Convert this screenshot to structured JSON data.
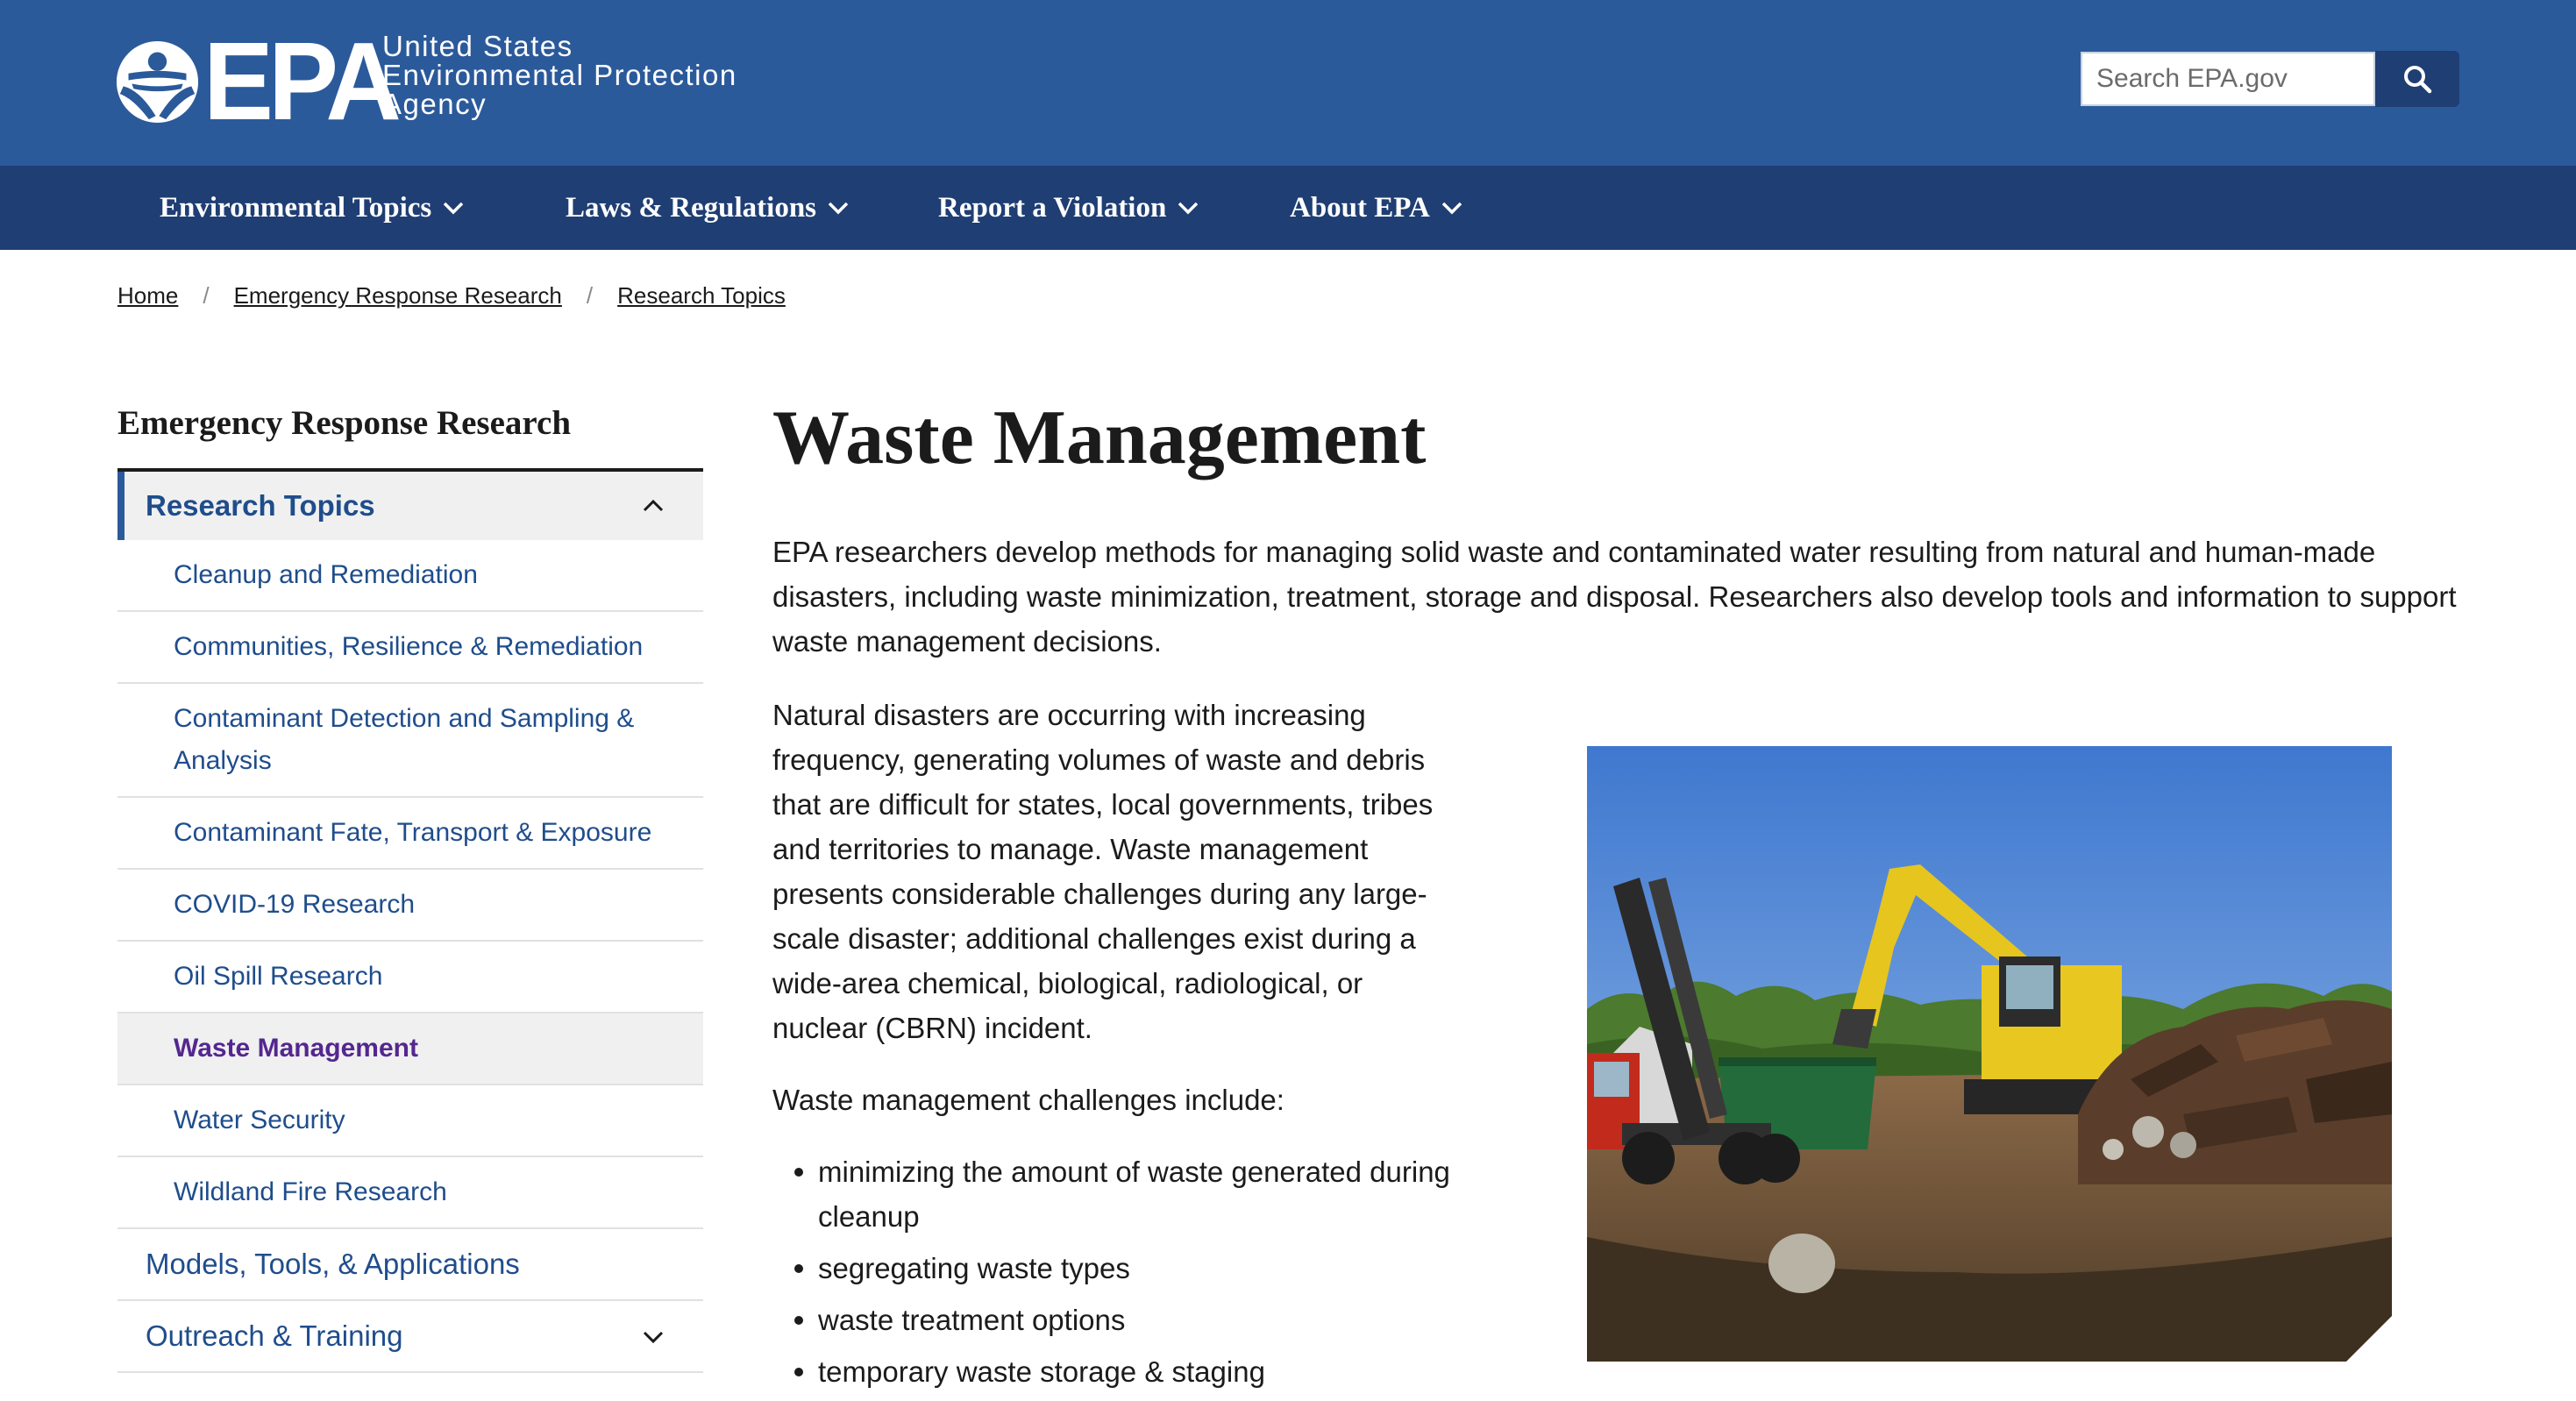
{
  "header": {
    "logo_word": "EPA",
    "agency_lines": [
      "United States",
      "Environmental Protection",
      "Agency"
    ],
    "search_placeholder": "Search EPA.gov"
  },
  "nav": {
    "items": [
      {
        "label": "Environmental Topics"
      },
      {
        "label": "Laws & Regulations"
      },
      {
        "label": "Report a Violation"
      },
      {
        "label": "About EPA"
      }
    ]
  },
  "breadcrumb": [
    "Home",
    "Emergency Response Research",
    "Research Topics"
  ],
  "sidebar": {
    "title": "Emergency Response Research",
    "parent": "Research Topics",
    "children": [
      "Cleanup and Remediation",
      "Communities, Resilience & Remediation",
      "Contaminant Detection and Sampling & Analysis",
      "Contaminant Fate, Transport & Exposure",
      "COVID-19 Research",
      "Oil Spill Research",
      "Waste Management",
      "Water Security",
      "Wildland Fire Research"
    ],
    "sections": [
      "Models, Tools, & Applications",
      "Outreach & Training"
    ]
  },
  "article": {
    "title": "Waste Management",
    "intro": "EPA researchers develop methods for managing solid waste and contaminated water resulting from natural and human-made disasters, including waste minimization, treatment, storage and disposal. Researchers also develop tools and information to support waste management decisions.",
    "paragraph": "Natural disasters are occurring with increasing frequency, generating volumes of waste and debris that are difficult for states, local governments, tribes and territories to manage. Waste management presents considerable challenges during any large-scale disaster; additional challenges exist during a wide-area chemical, biological, radiological, or nuclear (CBRN) incident.",
    "challenges_intro": "Waste management challenges include:",
    "challenges": [
      "minimizing the amount of waste generated during cleanup",
      "segregating waste types",
      "waste treatment options",
      "temporary waste storage & staging"
    ]
  },
  "colors": {
    "header_bg": "#2b5a9b",
    "nav_bg": "#1f3e73",
    "link": "#1f4d8c",
    "current": "#54278f"
  }
}
